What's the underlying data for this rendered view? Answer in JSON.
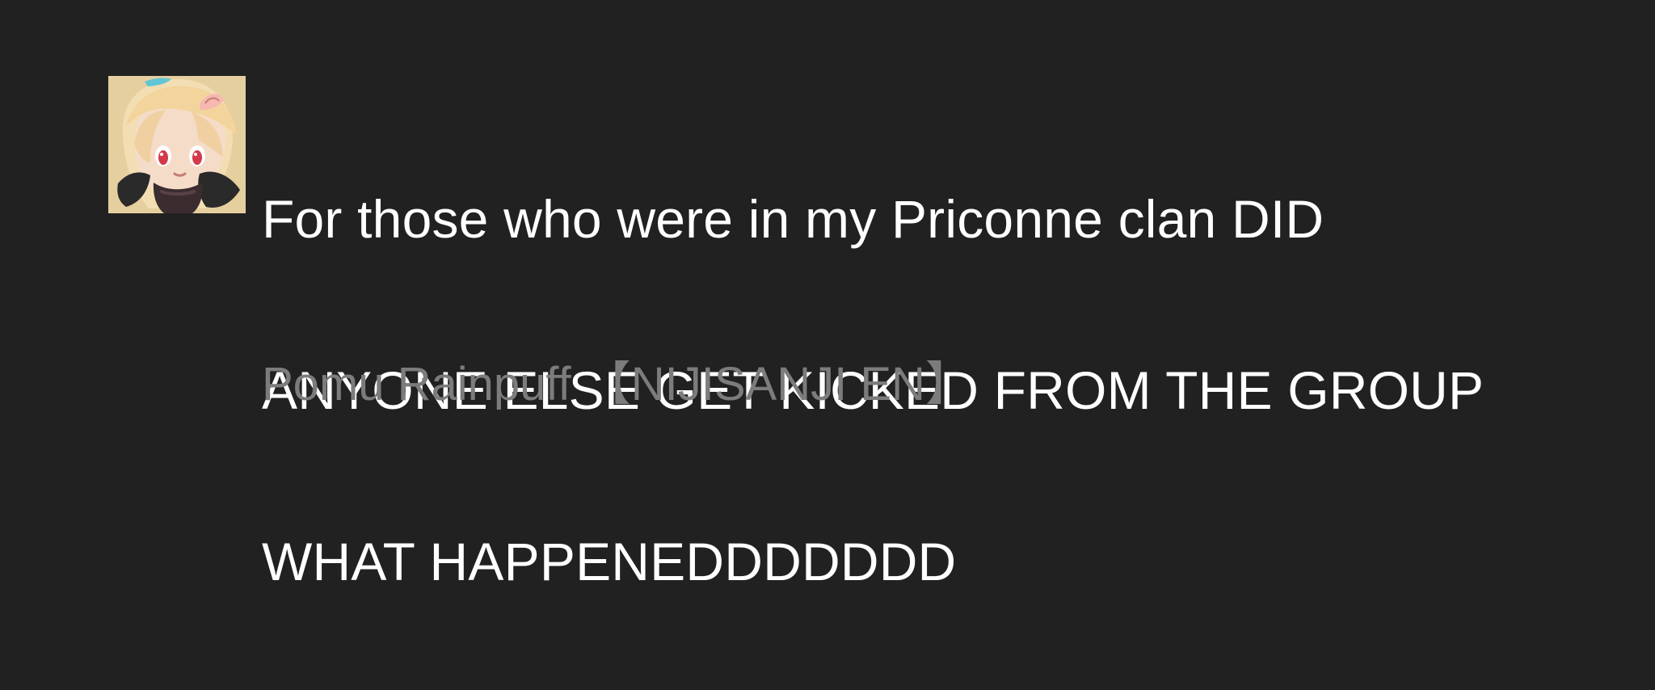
{
  "message": {
    "lines": [
      "For those who were in my Priconne clan DID",
      "ANYONE ELSE GET KICKED FROM THE GROUP",
      "WHAT HAPPENEDDDDDDD"
    ],
    "author": "Pomu Rainpuff 【NIJISANJI EN】"
  },
  "colors": {
    "background": "#212121",
    "message_text": "#ffffff",
    "author_text": "#7c7c7c"
  },
  "avatar": {
    "icon": "avatar-anime-girl"
  }
}
